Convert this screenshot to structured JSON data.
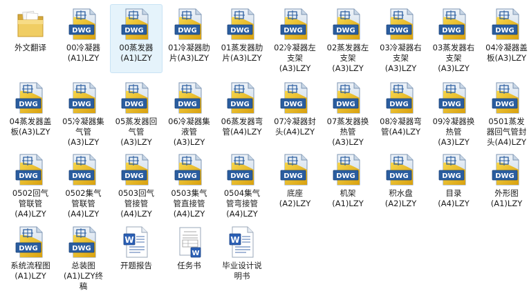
{
  "colors": {
    "selection_bg": "#e5f3fb",
    "dwg_gold": "#e7b718",
    "dwg_blue": "#2a5d9f",
    "folder": "#e8c35a"
  },
  "items": [
    {
      "label": "外文翻译",
      "icon": "folder-icon"
    },
    {
      "label": "00冷凝器\n(A1)LZY",
      "icon": "dwg-file-icon"
    },
    {
      "label": "00蒸发器\n(A1)LZY",
      "icon": "dwg-file-icon",
      "selected": true
    },
    {
      "label": "01冷凝器肋\n片(A3)LZY",
      "icon": "dwg-file-icon"
    },
    {
      "label": "01蒸发器肋\n片(A3)LZY",
      "icon": "dwg-file-icon"
    },
    {
      "label": "02冷凝器左\n支架\n(A3)LZY",
      "icon": "dwg-file-icon"
    },
    {
      "label": "02蒸发器左\n支架\n(A3)LZY",
      "icon": "dwg-file-icon"
    },
    {
      "label": "03冷凝器右\n支架\n(A3)LZY",
      "icon": "dwg-file-icon"
    },
    {
      "label": "03蒸发器右\n支架\n(A3)LZY",
      "icon": "dwg-file-icon"
    },
    {
      "label": "04冷凝器盖\n板(A3)LZY",
      "icon": "dwg-file-icon"
    },
    {
      "label": "04蒸发器盖\n板(A3)LZY",
      "icon": "dwg-file-icon"
    },
    {
      "label": "05冷凝器集\n气管\n(A3)LZY",
      "icon": "dwg-file-icon"
    },
    {
      "label": "05蒸发器回\n气管\n(A3)LZY",
      "icon": "dwg-file-icon"
    },
    {
      "label": "06冷凝器集\n液管\n(A3)LZY",
      "icon": "dwg-file-icon"
    },
    {
      "label": "06蒸发器弯\n管(A4)LZY",
      "icon": "dwg-file-icon"
    },
    {
      "label": "07冷凝器封\n头(A4)LZY",
      "icon": "dwg-file-icon"
    },
    {
      "label": "07蒸发器换\n热管\n(A3)LZY",
      "icon": "dwg-file-icon"
    },
    {
      "label": "08冷凝器弯\n管(A4)LZY",
      "icon": "dwg-file-icon"
    },
    {
      "label": "09冷凝器换\n热管\n(A3)LZY",
      "icon": "dwg-file-icon"
    },
    {
      "label": "0501蒸发\n器回气管封\n头(A4)LZY",
      "icon": "dwg-file-icon"
    },
    {
      "label": "0502回气\n管联管\n(A4)LZY",
      "icon": "dwg-file-icon"
    },
    {
      "label": "0502集气\n管联管\n(A4)LZY",
      "icon": "dwg-file-icon"
    },
    {
      "label": "0503回气\n管接管\n(A4)LZY",
      "icon": "dwg-file-icon"
    },
    {
      "label": "0503集气\n管直接管\n(A4)LZY",
      "icon": "dwg-file-icon"
    },
    {
      "label": "0504集气\n管弯接管\n(A4)LZY",
      "icon": "dwg-file-icon"
    },
    {
      "label": "底座\n(A2)LZY",
      "icon": "dwg-file-icon"
    },
    {
      "label": "机架\n(A1)LZY",
      "icon": "dwg-file-icon"
    },
    {
      "label": "积水盘\n(A2)LZY",
      "icon": "dwg-file-icon"
    },
    {
      "label": "目录\n(A4)LZY",
      "icon": "dwg-file-icon"
    },
    {
      "label": "外形图\n(A1)LZY",
      "icon": "dwg-file-icon"
    },
    {
      "label": "系统流程图\n(A1)LZY",
      "icon": "dwg-file-icon"
    },
    {
      "label": "总装图\n(A1)LZY终\n稿",
      "icon": "dwg-file-icon"
    },
    {
      "label": "开题报告",
      "icon": "word-doc-icon"
    },
    {
      "label": "任务书",
      "icon": "word-doc-preview-icon"
    },
    {
      "label": "毕业设计说\n明书",
      "icon": "word-doc-icon"
    }
  ]
}
